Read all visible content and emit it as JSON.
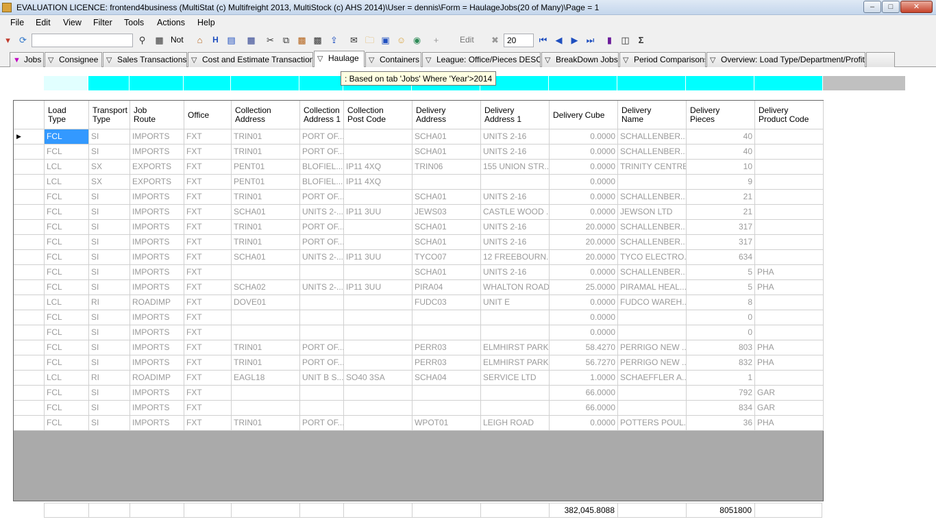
{
  "window": {
    "title": "EVALUATION LICENCE: frontend4business (MultiStat (c) Multifreight 2013, MultiStock (c) AHS 2014)\\User = dennis\\Form = HaulageJobs(20 of Many)\\Page = 1",
    "minimize": "–",
    "maximize": "□",
    "close": "✕"
  },
  "menu": {
    "file": "File",
    "edit": "Edit",
    "view": "View",
    "filter": "Filter",
    "tools": "Tools",
    "actions": "Actions",
    "help": "Help"
  },
  "toolbar": {
    "not_label": "Not",
    "h_label": "H",
    "edit_label": "Edit",
    "page_size": "20",
    "sigma": "Σ"
  },
  "tabs": [
    {
      "label": "Jobs"
    },
    {
      "label": "Consignee"
    },
    {
      "label": "Sales Transactions"
    },
    {
      "label": "Cost and Estimate Transactions"
    },
    {
      "label": "Haulage"
    },
    {
      "label": "Containers"
    },
    {
      "label": "League: Office/Pieces DESC"
    },
    {
      "label": "BreakDown Jobs"
    },
    {
      "label": "Period Comparisons"
    },
    {
      "label": "Overview: Load Type/Department/Profit..."
    }
  ],
  "tooltip": ": Based on tab 'Jobs' Where 'Year'>2014",
  "columns": [
    {
      "line1": "Load",
      "line2": "Type"
    },
    {
      "line1": "Transport",
      "line2": "Type"
    },
    {
      "line1": "Job",
      "line2": "Route"
    },
    {
      "line1": "Office",
      "line2": ""
    },
    {
      "line1": "Collection",
      "line2": "Address"
    },
    {
      "line1": "Collection",
      "line2": "Address 1"
    },
    {
      "line1": "Collection",
      "line2": "Post Code"
    },
    {
      "line1": "Delivery",
      "line2": "Address"
    },
    {
      "line1": "Delivery",
      "line2": "Address 1"
    },
    {
      "line1": "Delivery Cube",
      "line2": ""
    },
    {
      "line1": "Delivery",
      "line2": "Name"
    },
    {
      "line1": "Delivery",
      "line2": "Pieces"
    },
    {
      "line1": "Delivery",
      "line2": "Product Code"
    }
  ],
  "rows": [
    [
      "FCL",
      "SI",
      "IMPORTS",
      "FXT",
      "TRIN01",
      "PORT OF...",
      "",
      "SCHA01",
      "UNITS 2-16",
      "0.0000",
      "SCHALLENBER...",
      "40",
      ""
    ],
    [
      "FCL",
      "SI",
      "IMPORTS",
      "FXT",
      "TRIN01",
      "PORT OF...",
      "",
      "SCHA01",
      "UNITS 2-16",
      "0.0000",
      "SCHALLENBER...",
      "40",
      ""
    ],
    [
      "LCL",
      "SX",
      "EXPORTS",
      "FXT",
      "PENT01",
      "BLOFIEL...",
      "IP11 4XQ",
      "TRIN06",
      "155 UNION STR...",
      "0.0000",
      "TRINITY CENTRE",
      "10",
      ""
    ],
    [
      "LCL",
      "SX",
      "EXPORTS",
      "FXT",
      "PENT01",
      "BLOFIEL...",
      "IP11 4XQ",
      "",
      "",
      "0.0000",
      "",
      "9",
      ""
    ],
    [
      "FCL",
      "SI",
      "IMPORTS",
      "FXT",
      "TRIN01",
      "PORT OF...",
      "",
      "SCHA01",
      "UNITS 2-16",
      "0.0000",
      "SCHALLENBER...",
      "21",
      ""
    ],
    [
      "FCL",
      "SI",
      "IMPORTS",
      "FXT",
      "SCHA01",
      "UNITS 2-...",
      "IP11 3UU",
      "JEWS03",
      "CASTLE WOOD ...",
      "0.0000",
      "JEWSON LTD",
      "21",
      ""
    ],
    [
      "FCL",
      "SI",
      "IMPORTS",
      "FXT",
      "TRIN01",
      "PORT OF...",
      "",
      "SCHA01",
      "UNITS 2-16",
      "20.0000",
      "SCHALLENBER...",
      "317",
      ""
    ],
    [
      "FCL",
      "SI",
      "IMPORTS",
      "FXT",
      "TRIN01",
      "PORT OF...",
      "",
      "SCHA01",
      "UNITS 2-16",
      "20.0000",
      "SCHALLENBER...",
      "317",
      ""
    ],
    [
      "FCL",
      "SI",
      "IMPORTS",
      "FXT",
      "SCHA01",
      "UNITS 2-...",
      "IP11 3UU",
      "TYCO07",
      "12 FREEBOURN...",
      "20.0000",
      "TYCO ELECTRO...",
      "634",
      ""
    ],
    [
      "FCL",
      "SI",
      "IMPORTS",
      "FXT",
      "",
      "",
      "",
      "SCHA01",
      "UNITS 2-16",
      "0.0000",
      "SCHALLENBER...",
      "5",
      "PHA"
    ],
    [
      "FCL",
      "SI",
      "IMPORTS",
      "FXT",
      "SCHA02",
      "UNITS 2-...",
      "IP11 3UU",
      "PIRA04",
      "WHALTON ROAD",
      "25.0000",
      "PIRAMAL HEAL...",
      "5",
      "PHA"
    ],
    [
      "LCL",
      "RI",
      "ROADIMP",
      "FXT",
      "DOVE01",
      "",
      "",
      "FUDC03",
      "UNIT E",
      "0.0000",
      "FUDCO WAREH...",
      "8",
      ""
    ],
    [
      "FCL",
      "SI",
      "IMPORTS",
      "FXT",
      "",
      "",
      "",
      "",
      "",
      "0.0000",
      "",
      "0",
      ""
    ],
    [
      "FCL",
      "SI",
      "IMPORTS",
      "FXT",
      "",
      "",
      "",
      "",
      "",
      "0.0000",
      "",
      "0",
      ""
    ],
    [
      "FCL",
      "SI",
      "IMPORTS",
      "FXT",
      "TRIN01",
      "PORT OF...",
      "",
      "PERR03",
      "ELMHIRST PARK",
      "58.4270",
      "PERRIGO NEW ...",
      "803",
      "PHA"
    ],
    [
      "FCL",
      "SI",
      "IMPORTS",
      "FXT",
      "TRIN01",
      "PORT OF...",
      "",
      "PERR03",
      "ELMHIRST PARK",
      "56.7270",
      "PERRIGO NEW ...",
      "832",
      "PHA"
    ],
    [
      "LCL",
      "RI",
      "ROADIMP",
      "FXT",
      "EAGL18",
      "UNIT B S...",
      "SO40 3SA",
      "SCHA04",
      "SERVICE LTD",
      "1.0000",
      "SCHAEFFLER A...",
      "1",
      ""
    ],
    [
      "FCL",
      "SI",
      "IMPORTS",
      "FXT",
      "",
      "",
      "",
      "",
      "",
      "66.0000",
      "",
      "792",
      "GAR"
    ],
    [
      "FCL",
      "SI",
      "IMPORTS",
      "FXT",
      "",
      "",
      "",
      "",
      "",
      "66.0000",
      "",
      "834",
      "GAR"
    ],
    [
      "FCL",
      "SI",
      "IMPORTS",
      "FXT",
      "TRIN01",
      "PORT OF...",
      "",
      "WPOT01",
      "LEIGH ROAD",
      "0.0000",
      "POTTERS POUL...",
      "36",
      "PHA"
    ]
  ],
  "current_row_indicator": "▶",
  "totals": {
    "delivery_cube": "382,045.8088",
    "delivery_pieces": "8051800"
  }
}
